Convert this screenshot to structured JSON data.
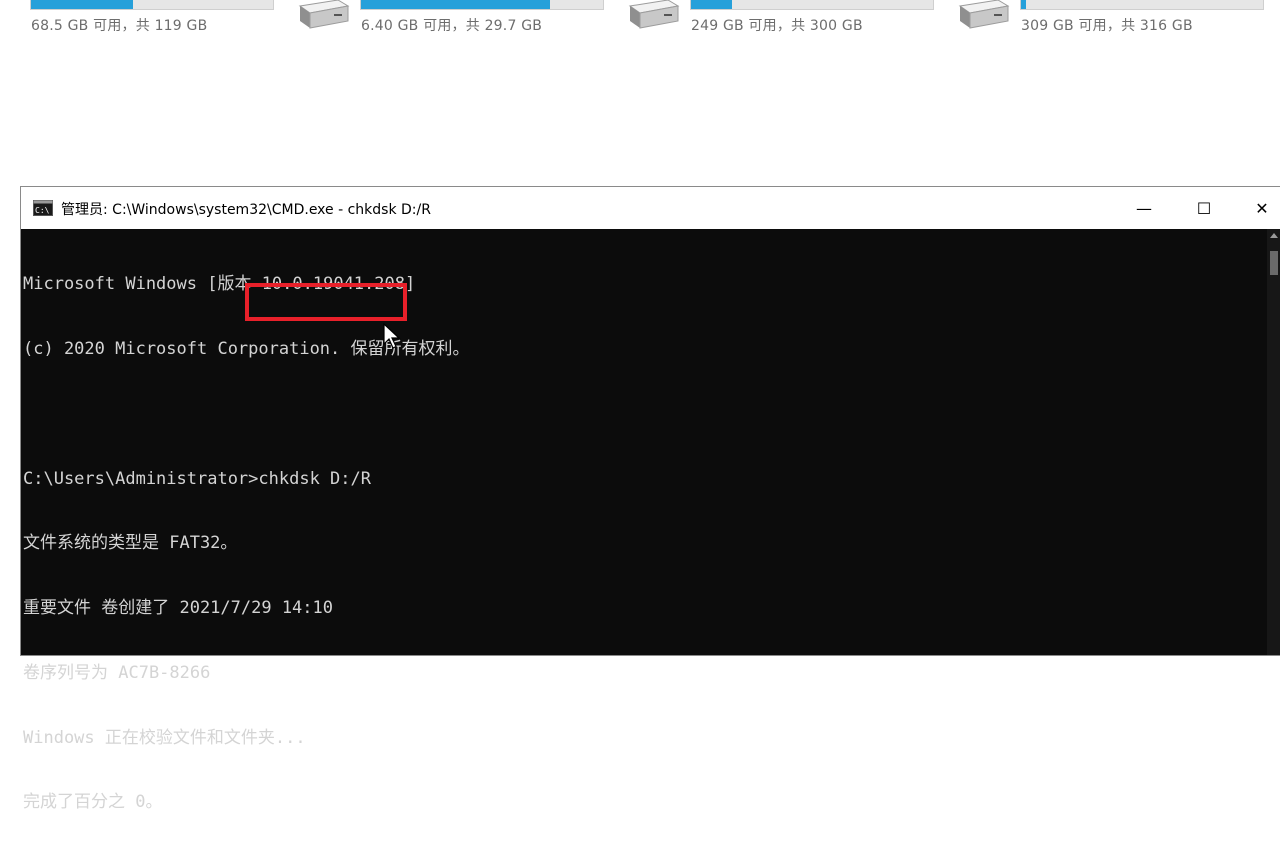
{
  "drives": [
    {
      "free_text": "68.5 GB 可用，共 119 GB",
      "used_fraction": 0.42
    },
    {
      "free_text": "6.40 GB 可用，共 29.7 GB",
      "used_fraction": 0.78
    },
    {
      "free_text": "249 GB 可用，共 300 GB",
      "used_fraction": 0.17
    },
    {
      "free_text": "309 GB 可用，共 316 GB",
      "used_fraction": 0.02
    }
  ],
  "window": {
    "title": "管理员: C:\\Windows\\system32\\CMD.exe - chkdsk  D:/R",
    "minimize_glyph": "—",
    "maximize_glyph": "☐",
    "close_glyph": "✕"
  },
  "console": {
    "lines": [
      "Microsoft Windows [版本 10.0.19041.208]",
      "(c) 2020 Microsoft Corporation. 保留所有权利。",
      "",
      "C:\\Users\\Administrator>chkdsk D:/R",
      "文件系统的类型是 FAT32。",
      "重要文件 卷创建了 2021/7/29 14:10",
      "卷序列号为 AC7B-8266",
      "Windows 正在校验文件和文件夹...",
      "完成了百分之 0。"
    ]
  },
  "colors": {
    "accent": "#26a0da",
    "highlight": "#e8202a",
    "console_bg": "#0c0c0c",
    "console_fg": "#d4d4d4"
  }
}
